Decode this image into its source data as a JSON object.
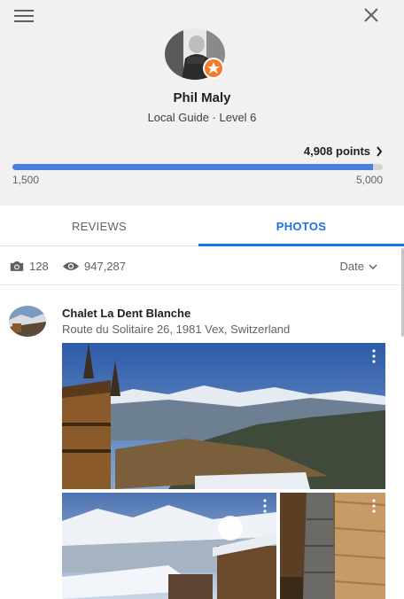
{
  "profile": {
    "name": "Phil Maly",
    "level": "Local Guide · Level 6"
  },
  "points": {
    "label": "4,908 points",
    "progress_percent": 97.4
  },
  "progress": {
    "min": "1,500",
    "max": "5,000"
  },
  "tabs": [
    {
      "label": "REVIEWS"
    },
    {
      "label": "PHOTOS"
    }
  ],
  "stats": {
    "photos_count": "128",
    "views_count": "947,287",
    "sort_label": "Date"
  },
  "place": {
    "name": "Chalet La Dent Blanche",
    "address": "Route du Solitaire 26, 1981 Vex, Switzerland"
  },
  "colors": {
    "accent": "#1a73e8",
    "progress": "#4a7ddc",
    "header_bg": "#f1f1f1",
    "badge": "#f57c23"
  },
  "icons": [
    "menu-icon",
    "close-icon",
    "chevron-right-icon",
    "camera-icon",
    "eye-icon",
    "chevron-down-icon",
    "more-vert-icon"
  ]
}
